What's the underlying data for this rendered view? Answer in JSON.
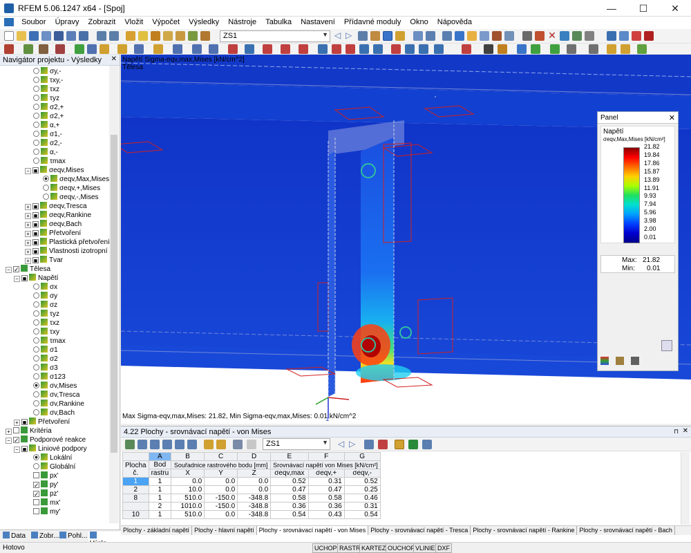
{
  "window": {
    "title": "RFEM 5.06.1247 x64 - [Spoj]",
    "minimize": "—",
    "maximize": "☐",
    "close": "✕"
  },
  "menu": [
    "Soubor",
    "Úpravy",
    "Zobrazit",
    "Vložit",
    "Výpočet",
    "Výsledky",
    "Nástroje",
    "Tabulka",
    "Nastavení",
    "Přídavné moduly",
    "Okno",
    "Nápověda"
  ],
  "toolbar": {
    "load_case": "ZS1"
  },
  "navigator": {
    "title": "Navigátor projektu - Výsledky",
    "items": [
      {
        "label": "σy,-",
        "kind": "rad"
      },
      {
        "label": "τxy,-",
        "kind": "rad"
      },
      {
        "label": "τxz",
        "kind": "rad"
      },
      {
        "label": "τyz",
        "kind": "rad"
      },
      {
        "label": "σ2,+",
        "kind": "rad"
      },
      {
        "label": "σ2,+",
        "kind": "rad"
      },
      {
        "label": "α,+",
        "kind": "rad"
      },
      {
        "label": "σ1,-",
        "kind": "rad"
      },
      {
        "label": "σ2,-",
        "kind": "rad"
      },
      {
        "label": "α,-",
        "kind": "rad"
      },
      {
        "label": "τmax",
        "kind": "rad"
      },
      {
        "label": "σeqv,Mises",
        "kind": "grp"
      },
      {
        "label": "σeqv,Max,Mises",
        "kind": "radon"
      },
      {
        "label": "σeqv,+,Mises",
        "kind": "rad"
      },
      {
        "label": "σeqv,-,Mises",
        "kind": "rad"
      },
      {
        "label": "σeqv,Tresca",
        "kind": "grp2"
      },
      {
        "label": "σeqv,Rankine",
        "kind": "grp2"
      },
      {
        "label": "σeqv,Bach",
        "kind": "grp2"
      },
      {
        "label": "Přetvoření",
        "kind": "grp2"
      },
      {
        "label": "Plastická přetvoření",
        "kind": "grp2"
      },
      {
        "label": "Vlastnosti izotropní ploch",
        "kind": "grp2"
      },
      {
        "label": "Tvar",
        "kind": "grp2"
      },
      {
        "label": "Tělesa",
        "kind": "top"
      },
      {
        "label": "Napětí",
        "kind": "sub"
      },
      {
        "label": "σx",
        "kind": "rad"
      },
      {
        "label": "σy",
        "kind": "rad"
      },
      {
        "label": "σz",
        "kind": "rad"
      },
      {
        "label": "τyz",
        "kind": "rad"
      },
      {
        "label": "τxz",
        "kind": "rad"
      },
      {
        "label": "τxy",
        "kind": "rad"
      },
      {
        "label": "τmax",
        "kind": "rad"
      },
      {
        "label": "σ1",
        "kind": "rad"
      },
      {
        "label": "σ2",
        "kind": "rad"
      },
      {
        "label": "σ3",
        "kind": "rad"
      },
      {
        "label": "σ123",
        "kind": "rad"
      },
      {
        "label": "σv,Mises",
        "kind": "radon"
      },
      {
        "label": "σv,Tresca",
        "kind": "rad"
      },
      {
        "label": "σv,Rankine",
        "kind": "rad"
      },
      {
        "label": "σv,Bach",
        "kind": "rad"
      },
      {
        "label": "Přetvoření",
        "kind": "sub"
      },
      {
        "label": "Kritéria",
        "kind": "top"
      },
      {
        "label": "Podporové reakce",
        "kind": "top"
      },
      {
        "label": "Liniové podpory",
        "kind": "sub"
      },
      {
        "label": "Lokální",
        "kind": "radon"
      },
      {
        "label": "Globální",
        "kind": "rad"
      },
      {
        "label": "px'",
        "kind": "chk"
      },
      {
        "label": "py'",
        "kind": "chkon"
      },
      {
        "label": "pz'",
        "kind": "chkon"
      },
      {
        "label": "mx'",
        "kind": "chk"
      },
      {
        "label": "my'",
        "kind": "chk"
      }
    ],
    "tabs": [
      "Data",
      "Zobr...",
      "Pohl...",
      "Výsle..."
    ]
  },
  "viewport": {
    "header_line1": "Napětí Sigma-eqv,max,Mises [kN/cm^2]",
    "header_line2": "Tělesa",
    "footer": "Max Sigma-eqv,max,Mises: 21.82, Min Sigma-eqv,max,Mises: 0.01 kN/cm^2",
    "axis_z": "z"
  },
  "panel": {
    "title": "Panel",
    "quantity": "Napětí",
    "component": "σeqv,Max,Mises [kN/cm²]",
    "levels": [
      "21.82",
      "19.84",
      "17.86",
      "15.87",
      "13.89",
      "11.91",
      "9.93",
      "7.94",
      "5.96",
      "3.98",
      "2.00",
      "0.01"
    ],
    "max_label": "Max:",
    "max_value": "21.82",
    "min_label": "Min:",
    "min_value": "0.01"
  },
  "table": {
    "title": "4.22 Plochy - srovnávací napětí - von Mises",
    "load_case": "ZS1",
    "col_letters": [
      "A",
      "B",
      "C",
      "D",
      "E",
      "F",
      "G"
    ],
    "head1": [
      "Plocha",
      "Bod",
      "Souřadnice rastrového bodu [mm]",
      "Srovnávací napětí von Mises [kN/cm²]"
    ],
    "head2": [
      "č.",
      "rastru",
      "X",
      "Y",
      "Z",
      "σeqv,max",
      "σeqv,+",
      "σeqv,-"
    ],
    "rows": [
      {
        "plocha": "1",
        "bod": "1",
        "x": "0.0",
        "y": "0.0",
        "z": "0.0",
        "max": "0.52",
        "plus": "0.31",
        "minus": "0.52"
      },
      {
        "plocha": "2",
        "bod": "1",
        "x": "10.0",
        "y": "0.0",
        "z": "0.0",
        "max": "0.47",
        "plus": "0.47",
        "minus": "0.25"
      },
      {
        "plocha": "8",
        "bod": "1",
        "x": "510.0",
        "y": "-150.0",
        "z": "-348.8",
        "max": "0.58",
        "plus": "0.58",
        "minus": "0.46"
      },
      {
        "plocha": "",
        "bod": "2",
        "x": "1010.0",
        "y": "-150.0",
        "z": "-348.8",
        "max": "0.36",
        "plus": "0.36",
        "minus": "0.31"
      },
      {
        "plocha": "10",
        "bod": "1",
        "x": "510.0",
        "y": "0.0",
        "z": "-348.8",
        "max": "0.54",
        "plus": "0.43",
        "minus": "0.54"
      }
    ],
    "tabs": [
      "Plochy - základní napětí",
      "Plochy - hlavní napětí",
      "Plochy - srovnávací napětí - von Mises",
      "Plochy - srovnávací napětí - Tresca",
      "Plochy - srovnávací napětí - Rankine",
      "Plochy - srovnávací napětí - Bach"
    ]
  },
  "status": {
    "text": "Hotovo",
    "buttons": [
      "UCHOP",
      "RASTR",
      "KARTEZ",
      "OUCHOP",
      "VLINIE",
      "DXF"
    ]
  }
}
